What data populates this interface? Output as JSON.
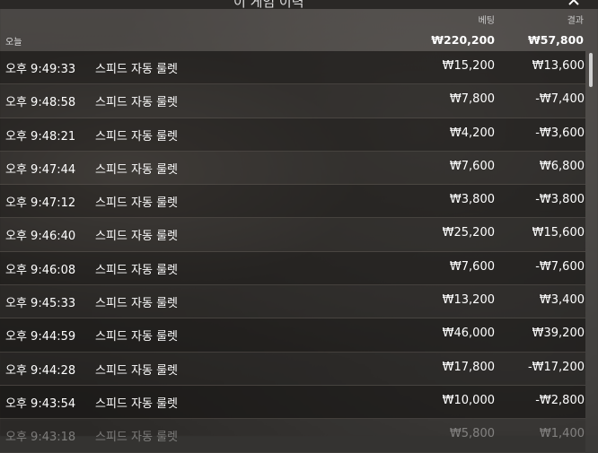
{
  "header": {
    "title": "이 게임 이력",
    "close_icon": "close-icon"
  },
  "columns": {
    "bet": "베팅",
    "result": "결과"
  },
  "summary": {
    "label": "오늘",
    "bet": "₩220,200",
    "result": "₩57,800"
  },
  "rows": [
    {
      "time": "오후 9:49:33",
      "game": "스피드 자동 룰렛",
      "bet": "₩15,200",
      "result": "₩13,600"
    },
    {
      "time": "오후 9:48:58",
      "game": "스피드 자동 룰렛",
      "bet": "₩7,800",
      "result": "-₩7,400"
    },
    {
      "time": "오후 9:48:21",
      "game": "스피드 자동 룰렛",
      "bet": "₩4,200",
      "result": "-₩3,600"
    },
    {
      "time": "오후 9:47:44",
      "game": "스피드 자동 룰렛",
      "bet": "₩7,600",
      "result": "₩6,800"
    },
    {
      "time": "오후 9:47:12",
      "game": "스피드 자동 룰렛",
      "bet": "₩3,800",
      "result": "-₩3,800"
    },
    {
      "time": "오후 9:46:40",
      "game": "스피드 자동 룰렛",
      "bet": "₩25,200",
      "result": "₩15,600"
    },
    {
      "time": "오후 9:46:08",
      "game": "스피드 자동 룰렛",
      "bet": "₩7,600",
      "result": "-₩7,600"
    },
    {
      "time": "오후 9:45:33",
      "game": "스피드 자동 룰렛",
      "bet": "₩13,200",
      "result": "₩3,400"
    },
    {
      "time": "오후 9:44:59",
      "game": "스피드 자동 룰렛",
      "bet": "₩46,000",
      "result": "₩39,200"
    },
    {
      "time": "오후 9:44:28",
      "game": "스피드 자동 룰렛",
      "bet": "₩17,800",
      "result": "-₩17,200"
    },
    {
      "time": "오후 9:43:54",
      "game": "스피드 자동 룰렛",
      "bet": "₩10,000",
      "result": "-₩2,800"
    },
    {
      "time": "오후 9:43:18",
      "game": "스피드 자동 룰렛",
      "bet": "₩5,800",
      "result": "₩1,400"
    }
  ]
}
